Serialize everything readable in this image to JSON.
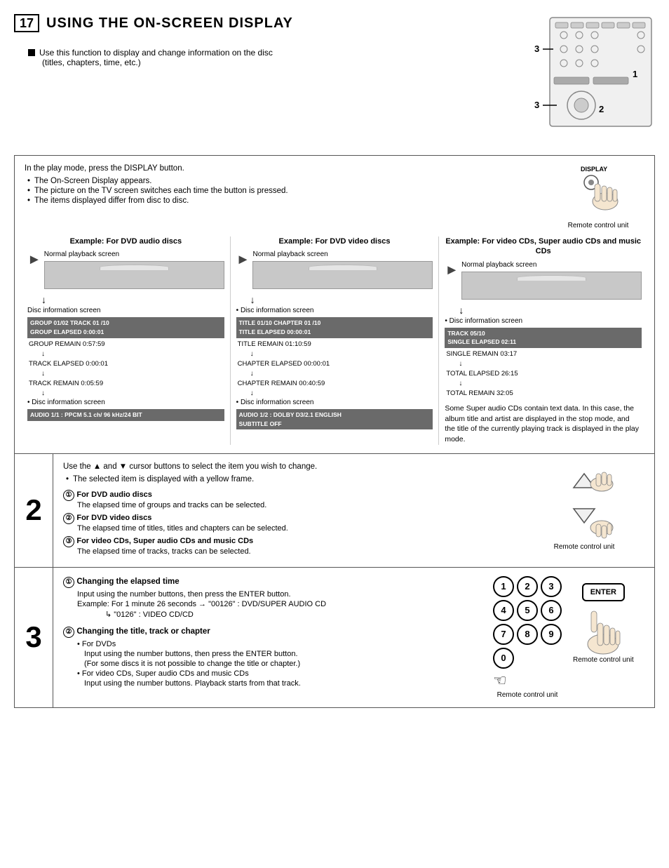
{
  "header": {
    "section_number": "17",
    "title": "USING THE ON-SCREEN DISPLAY"
  },
  "description": {
    "main": "Use this function to display and change information on the disc",
    "sub": "(titles, chapters, time, etc.)"
  },
  "diagram_labels": {
    "label1": "1",
    "label2": "2",
    "label3_top": "3",
    "label3_bottom": "3"
  },
  "intro": {
    "main": "In the play mode, press the DISPLAY button.",
    "bullets": [
      "The On-Screen Display appears.",
      "The picture on the TV screen switches each time the button is pressed.",
      "The items displayed differ from disc to disc."
    ],
    "remote_label": "Remote control unit"
  },
  "examples": {
    "col1": {
      "title": "Example: For DVD audio discs",
      "normal_label": "Normal playback screen",
      "disc_info_label1": "Disc information screen",
      "info_bar1_line1": "GROUP   01/02   TRACK   01 /10",
      "info_bar1_line2": "GROUP ELAPSED   0:00:01",
      "row1": "GROUP REMAIN   0:57:59",
      "row2": "TRACK ELAPSED   0:00:01",
      "row3": "TRACK REMAIN   0:05:59",
      "disc_info_label2": "Disc information screen",
      "info_bar2": "AUDIO 1/1 : PPCM   5.1 ch/  96 kHz/24 BIT"
    },
    "col2": {
      "title": "Example: For DVD video discs",
      "normal_label": "Normal playback screen",
      "disc_info_label1": "Disc information screen",
      "info_bar1_line1": "TITLE   01/10   CHAPTER  01 /10",
      "info_bar1_line2": "TITLE ELAPSED   00:00:01",
      "row1": "TITLE REMAIN   01:10:59",
      "row2": "CHAPTER ELAPSED   00:00:01",
      "row3": "CHAPTER REMAIN   00:40:59",
      "disc_info_label2": "Disc information screen",
      "info_bar2_line1": "AUDIO 1/2 : DOLBY D3/2.1 ENGLISH",
      "info_bar2_line2": "SUBTITLE   OFF"
    },
    "col3": {
      "title": "Example: For video CDs, Super audio CDs and music CDs",
      "normal_label": "Normal playback screen",
      "disc_info_label1": "Disc information screen",
      "info_bar1_line1": "TRACK   05/10",
      "info_bar1_line2": "SINGLE ELAPSED   02:11",
      "row1": "SINGLE REMAIN   03:17",
      "row2": "TOTAL ELAPSED   26:15",
      "row3": "TOTAL REMAIN   32:05",
      "side_note": "Some Super audio CDs contain text data. In this case, the album title and artist are displayed in the stop mode, and the title of the currently playing track is displayed in the play mode."
    }
  },
  "step2": {
    "number": "2",
    "main": "Use the ▲ and ▼ cursor buttons to select the item you wish to change.",
    "bullets": [
      "The selected item is displayed with a yellow frame."
    ],
    "items": [
      {
        "num": "①",
        "title": "For DVD audio discs",
        "desc": "The elapsed time of groups and tracks can be selected."
      },
      {
        "num": "②",
        "title": "For DVD video discs",
        "desc": "The elapsed time of titles, titles and chapters can be selected."
      },
      {
        "num": "③",
        "title": "For video CDs, Super audio CDs and music CDs",
        "desc": "The elapsed time of tracks, tracks can be selected."
      }
    ],
    "remote_label": "Remote control unit"
  },
  "step3": {
    "number": "3",
    "items": [
      {
        "num": "①",
        "title": "Changing the elapsed time",
        "desc1": "Input using the number buttons, then press the ENTER button.",
        "desc2": "Example: For 1 minute 26 seconds → \"00126\" : DVD/SUPER AUDIO CD",
        "desc3": "↳ \"0126\"  : VIDEO CD/CD"
      },
      {
        "num": "②",
        "title": "Changing the title, track or chapter",
        "sub1": "• For DVDs",
        "sub1_desc": "Input using the number buttons, then press the ENTER button.",
        "sub1_note": "(For some discs it is not possible to change the title or chapter.)",
        "sub2": "• For video CDs, Super audio CDs and music CDs",
        "sub2_desc": "Input using the number buttons. Playback starts from that track."
      }
    ],
    "numpad_buttons": [
      "1",
      "2",
      "3",
      "4",
      "5",
      "6",
      "7",
      "8",
      "9"
    ],
    "zero_button": "0",
    "remote_label1": "Remote control unit",
    "remote_label2": "Remote control unit",
    "enter_label": "ENTER"
  }
}
